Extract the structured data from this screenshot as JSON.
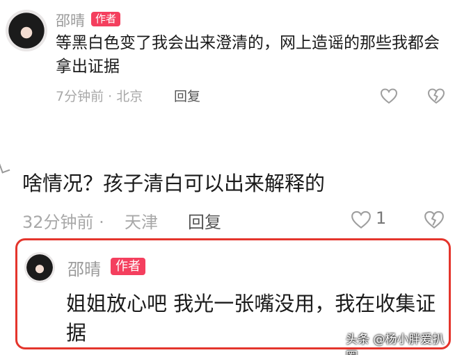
{
  "comment1": {
    "author": "邵晴",
    "badge": "作者",
    "text": "等黑白色变了我会出来澄清的，网上造谣的那些我都会拿出证据",
    "meta": "7分钟前 · 北京",
    "reply_label": "回复"
  },
  "comment2": {
    "text": "啥情况？孩子清白可以出来解释的",
    "time": "32分钟前 ·",
    "location": "天津",
    "reply_label": "回复",
    "like_count": "1"
  },
  "highlighted_reply": {
    "author": "邵晴",
    "badge": "作者",
    "text": "姐姐放心吧 我光一张嘴没用，我在收集证据",
    "border_color": "#e4352c"
  },
  "watermark": "头条 @杨小胖爱扒圈",
  "colors": {
    "badge": "#f43f5e",
    "secondary_text": "#a8a8a8"
  }
}
